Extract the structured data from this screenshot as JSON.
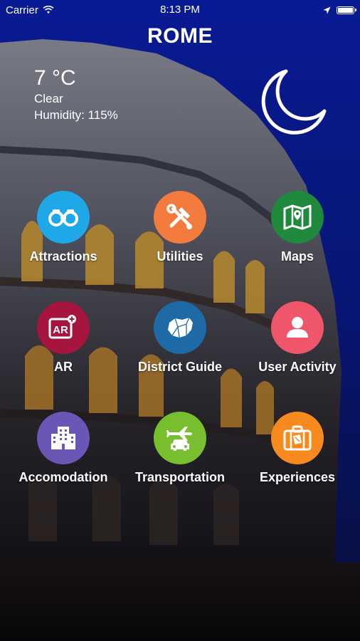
{
  "status_bar": {
    "carrier": "Carrier",
    "time": "8:13 PM"
  },
  "city": "ROME",
  "weather": {
    "temperature": "7 °C",
    "condition": "Clear",
    "humidity": "Humidity: 115%",
    "icon": "moon-icon"
  },
  "menu": [
    {
      "label": "Attractions",
      "icon": "binoculars-icon",
      "color": "#1fa8e8"
    },
    {
      "label": "Utilities",
      "icon": "tools-icon",
      "color": "#f47b3e"
    },
    {
      "label": "Maps",
      "icon": "map-icon",
      "color": "#1f8a3e"
    },
    {
      "label": "AR",
      "icon": "ar-icon",
      "color": "#a5153d"
    },
    {
      "label": "District Guide",
      "icon": "district-map-icon",
      "color": "#1d6aa6"
    },
    {
      "label": "User Activity",
      "icon": "user-icon",
      "color": "#f0566b"
    },
    {
      "label": "Accomodation",
      "icon": "building-icon",
      "color": "#6a56b5"
    },
    {
      "label": "Transportation",
      "icon": "transport-icon",
      "color": "#78bf2f"
    },
    {
      "label": "Experiences",
      "icon": "suitcase-icon",
      "color": "#f78a1f"
    }
  ]
}
